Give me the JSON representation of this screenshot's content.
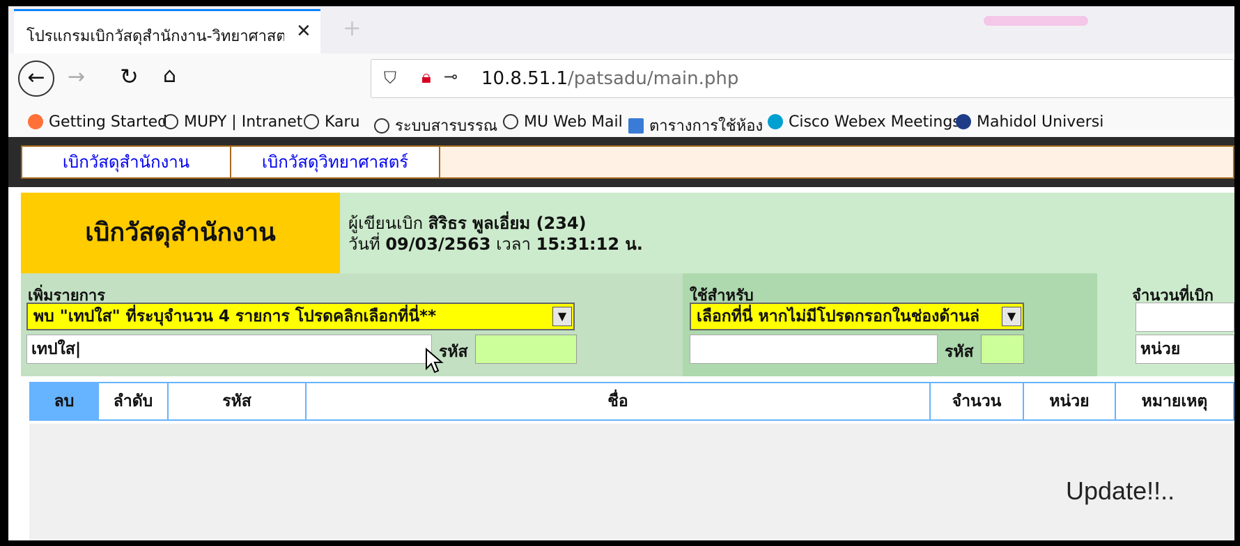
{
  "browser": {
    "tab_title": "โปรแกรมเบิกวัสดุสำนักงาน-วิทยาศาสต",
    "url_host": "10.8.51.1",
    "url_path": "/patsadu/main.php",
    "bookmarks": [
      {
        "label": "Getting Started",
        "icon": "firefox-icon",
        "color": "#ff7139"
      },
      {
        "label": "MUPY | Intranet",
        "icon": "globe-icon",
        "color": "#333333"
      },
      {
        "label": "Karu",
        "icon": "globe-icon",
        "color": "#333333"
      },
      {
        "label": "ระบบสารบรรณ",
        "icon": "globe-icon",
        "color": "#333333"
      },
      {
        "label": "MU Web Mail",
        "icon": "globe-icon",
        "color": "#333333"
      },
      {
        "label": "ตารางการใช้ห้อง",
        "icon": "calendar-icon",
        "color": "#3a7bd5"
      },
      {
        "label": "Cisco Webex Meetings",
        "icon": "webex-icon",
        "color": "#00a0d1"
      },
      {
        "label": "Mahidol Universi",
        "icon": "seal-icon",
        "color": "#1f3c88"
      }
    ]
  },
  "menu": {
    "item1": "เบิกวัสดุสำนักงาน",
    "item2": "เบิกวัสดุวิทยาศาสตร์"
  },
  "header": {
    "title": "เบิกวัสดุสำนักงาน",
    "writer_label": "ผู้เขียนเบิก",
    "writer_name": "สิริธร พูลเอี่ยม (234)",
    "date_label": "วันที่",
    "date_value": "09/03/2563",
    "time_label": "เวลา",
    "time_value": "15:31:12 น."
  },
  "form": {
    "add_item_label": "เพิ่มรายการ",
    "add_item_select": "พบ \"เทปใส\" ที่ระบุจำนวน 4 รายการ โปรดคลิกเลือกที่นี่**",
    "search_value": "เทปใส",
    "code_label": "รหัส",
    "use_for_label": "ใช้สำหรับ",
    "use_for_select": "เลือกที่นี่ หากไม่มีโปรดกรอกในช่องด้านล่",
    "use_for_code_label": "รหัส",
    "qty_label": "จำนวนที่เบิก",
    "unit_value": "หน่วย"
  },
  "table": {
    "columns": [
      "ลบ",
      "ลำดับ",
      "รหัส",
      "ชื่อ",
      "จำนวน",
      "หน่วย",
      "หมายเหตุ"
    ]
  },
  "status": {
    "update_text": "Update!!.."
  },
  "colors": {
    "title_bg": "#ffcc00",
    "header_bg": "#ccebcc",
    "select_bg": "#ffff00",
    "table_border": "#66b3ff"
  }
}
